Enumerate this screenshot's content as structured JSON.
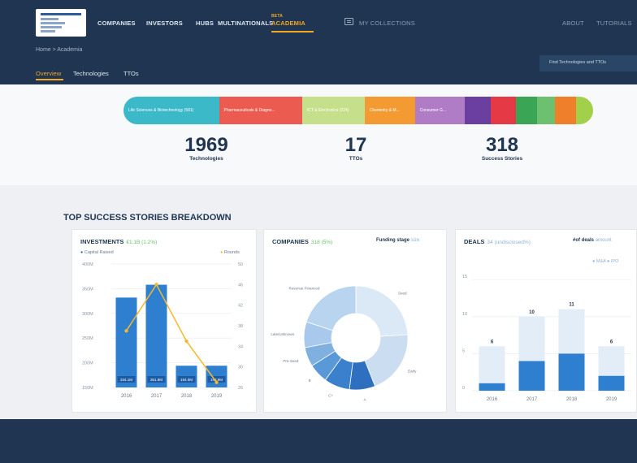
{
  "nav": {
    "items": [
      "COMPANIES",
      "INVESTORS",
      "HUBS",
      "MULTINATIONALS",
      "ACADEMIA"
    ],
    "active_tag": "BETA",
    "collections": "MY COLLECTIONS",
    "about": "ABOUT",
    "tutorials": "TUTORIALS"
  },
  "breadcrumb": "Home > Academia",
  "subtabs": [
    "Overview",
    "Technologies",
    "TTOs"
  ],
  "find_button": "Find Technologies and TTOs",
  "pill": [
    {
      "label": "Life Sciences & Biotechnology (581)",
      "color": "#3bb9c9",
      "flex": 22
    },
    {
      "label": "Pharmaceuticals & Diagno...",
      "color": "#ec5b4f",
      "flex": 19
    },
    {
      "label": "ICT & Electronics (224)",
      "color": "#c6df8b",
      "flex": 14
    },
    {
      "label": "Chemistry & M...",
      "color": "#f49a33",
      "flex": 11
    },
    {
      "label": "Consumer G...",
      "color": "#b07cc6",
      "flex": 11
    },
    {
      "label": "",
      "color": "#6a3fa0",
      "flex": 5
    },
    {
      "label": "",
      "color": "#e63946",
      "flex": 5
    },
    {
      "label": "",
      "color": "#3aa655",
      "flex": 4
    },
    {
      "label": "",
      "color": "#6cc070",
      "flex": 3
    },
    {
      "label": "",
      "color": "#f07f2c",
      "flex": 4
    },
    {
      "label": "",
      "color": "#a2d04a",
      "flex": 3
    }
  ],
  "stats": [
    {
      "value": "1969",
      "label": "Technologies"
    },
    {
      "value": "17",
      "label": "TTOs"
    },
    {
      "value": "318",
      "label": "Success Stories"
    }
  ],
  "section_title": "TOP SUCCESS STORIES BREAKDOWN",
  "investments": {
    "title": "INVESTMENTS",
    "sub": "€1.1B (1.2%)",
    "legend_left": "Capital Raised",
    "legend_right": "Rounds",
    "y_left_ticks": [
      "400M",
      "350M",
      "300M",
      "250M",
      "200M",
      "150M"
    ],
    "y_right_ticks": [
      "50",
      "46",
      "42",
      "38",
      "34",
      "30",
      "26"
    ],
    "chart_data": {
      "type": "bar",
      "categories": [
        "2016",
        "2017",
        "2018",
        "2019"
      ],
      "series": [
        {
          "name": "Capital Raised",
          "values": [
            332,
            358,
            194,
            194
          ]
        },
        {
          "name": "Rounds",
          "values": [
            37,
            46,
            35,
            27
          ]
        }
      ],
      "bar_labels": [
        "334.1M",
        "361.8M",
        "194.0M",
        "193.9M"
      ]
    }
  },
  "companies": {
    "title": "COMPANIES",
    "sub": "318 (5%)",
    "right_label": "Funding stage",
    "right_alt": "size",
    "chart_data": {
      "type": "pie",
      "labels": [
        "Seed",
        "Early",
        "A",
        "C+",
        "B",
        "Pre-Seed",
        "Late/Unknown",
        "Revenue Financed"
      ],
      "values": [
        24,
        20,
        8,
        8,
        6,
        6,
        8,
        20
      ],
      "colors": [
        "#dbe8f5",
        "#cbddf0",
        "#2e6fbf",
        "#3b80cc",
        "#5a99d8",
        "#7fb0e0",
        "#a8c9eb",
        "#b9d4ef"
      ]
    }
  },
  "deals": {
    "title": "DEALS",
    "sub": "34 (undisclosed%)",
    "right_label": "#of deals",
    "right_alt": "amount",
    "legend": [
      "M&A",
      "IPO"
    ],
    "y_ticks": [
      "15",
      "10",
      "5",
      "0"
    ],
    "chart_data": {
      "type": "bar",
      "categories": [
        "2016",
        "2017",
        "2018",
        "2019"
      ],
      "series": [
        {
          "name": "total",
          "values": [
            6,
            10,
            11,
            6
          ]
        },
        {
          "name": "M&A",
          "values": [
            1,
            4,
            5,
            2
          ]
        }
      ],
      "ylim": [
        0,
        16
      ],
      "top_labels": [
        "6",
        "10",
        "11",
        "6"
      ]
    }
  }
}
